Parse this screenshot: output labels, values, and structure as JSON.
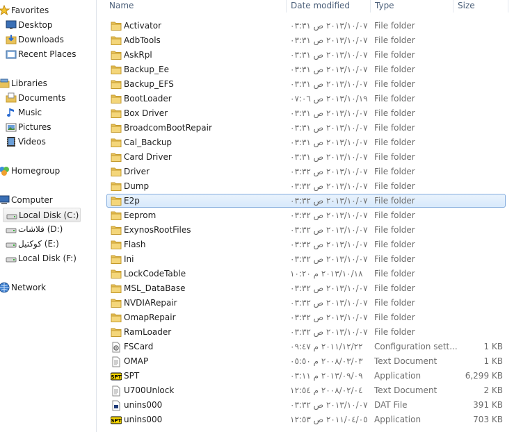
{
  "columns": {
    "name": "Name",
    "date": "Date modified",
    "type": "Type",
    "size": "Size"
  },
  "nav": [
    {
      "label": "Favorites",
      "icon": "star-icon",
      "group": "favorites"
    },
    {
      "label": "Desktop",
      "icon": "desktop-icon"
    },
    {
      "label": "Downloads",
      "icon": "downloads-icon"
    },
    {
      "label": "Recent Places",
      "icon": "recent-places-icon"
    },
    {
      "label": "Libraries",
      "icon": "libraries-icon",
      "group": "libraries"
    },
    {
      "label": "Documents",
      "icon": "documents-icon"
    },
    {
      "label": "Music",
      "icon": "music-icon"
    },
    {
      "label": "Pictures",
      "icon": "pictures-icon"
    },
    {
      "label": "Videos",
      "icon": "videos-icon"
    },
    {
      "label": "Homegroup",
      "icon": "homegroup-icon",
      "group": "homegroup"
    },
    {
      "label": "Computer",
      "icon": "computer-icon",
      "group": "computer"
    },
    {
      "label": "Local Disk (C:)",
      "icon": "drive-icon",
      "selected": true
    },
    {
      "label": "فلاشات (D:)",
      "icon": "drive-icon"
    },
    {
      "label": "كوكتيل (E:)",
      "icon": "drive-icon"
    },
    {
      "label": "Local Disk (F:)",
      "icon": "drive-icon"
    },
    {
      "label": "Network",
      "icon": "network-icon",
      "group": "network"
    }
  ],
  "files": [
    {
      "name": "Activator",
      "date": "٢٠١٣/١٠/٠٧ ص ٠٣:٣١",
      "type": "File folder",
      "size": "",
      "icon": "folder-icon"
    },
    {
      "name": "AdbTools",
      "date": "٢٠١٣/١٠/٠٧ ص ٠٣:٣١",
      "type": "File folder",
      "size": "",
      "icon": "folder-icon"
    },
    {
      "name": "AskRpl",
      "date": "٢٠١٣/١٠/٠٧ ص ٠٣:٣١",
      "type": "File folder",
      "size": "",
      "icon": "folder-icon"
    },
    {
      "name": "Backup_Ee",
      "date": "٢٠١٣/١٠/٠٧ ص ٠٣:٣١",
      "type": "File folder",
      "size": "",
      "icon": "folder-icon"
    },
    {
      "name": "Backup_EFS",
      "date": "٢٠١٣/١٠/٠٧ ص ٠٣:٣١",
      "type": "File folder",
      "size": "",
      "icon": "folder-icon"
    },
    {
      "name": "BootLoader",
      "date": "٢٠١٣/١٠/١٩ ص ٠٧:٠٦",
      "type": "File folder",
      "size": "",
      "icon": "folder-icon"
    },
    {
      "name": "Box Driver",
      "date": "٢٠١٣/١٠/٠٧ ص ٠٣:٣١",
      "type": "File folder",
      "size": "",
      "icon": "folder-icon"
    },
    {
      "name": "BroadcomBootRepair",
      "date": "٢٠١٣/١٠/٠٧ ص ٠٣:٣١",
      "type": "File folder",
      "size": "",
      "icon": "folder-icon"
    },
    {
      "name": "Cal_Backup",
      "date": "٢٠١٣/١٠/٠٧ ص ٠٣:٣١",
      "type": "File folder",
      "size": "",
      "icon": "folder-icon"
    },
    {
      "name": "Card Driver",
      "date": "٢٠١٣/١٠/٠٧ ص ٠٣:٣١",
      "type": "File folder",
      "size": "",
      "icon": "folder-icon"
    },
    {
      "name": "Driver",
      "date": "٢٠١٣/١٠/٠٧ ص ٠٣:٣٢",
      "type": "File folder",
      "size": "",
      "icon": "folder-icon"
    },
    {
      "name": "Dump",
      "date": "٢٠١٣/١٠/٠٧ ص ٠٣:٣٢",
      "type": "File folder",
      "size": "",
      "icon": "folder-icon"
    },
    {
      "name": "E2p",
      "date": "٢٠١٣/١٠/٠٧ ص ٠٣:٣٢",
      "type": "File folder",
      "size": "",
      "icon": "folder-icon",
      "selected": true
    },
    {
      "name": "Eeprom",
      "date": "٢٠١٣/١٠/٠٧ ص ٠٣:٣٢",
      "type": "File folder",
      "size": "",
      "icon": "folder-icon"
    },
    {
      "name": "ExynosRootFiles",
      "date": "٢٠١٣/١٠/٠٧ ص ٠٣:٣٢",
      "type": "File folder",
      "size": "",
      "icon": "folder-icon"
    },
    {
      "name": "Flash",
      "date": "٢٠١٣/١٠/٠٧ ص ٠٣:٣٢",
      "type": "File folder",
      "size": "",
      "icon": "folder-icon"
    },
    {
      "name": "Ini",
      "date": "٢٠١٣/١٠/٠٧ ص ٠٣:٣٢",
      "type": "File folder",
      "size": "",
      "icon": "folder-icon"
    },
    {
      "name": "LockCodeTable",
      "date": "٢٠١٣/١٠/١٨ م ١٠:٢٠",
      "type": "File folder",
      "size": "",
      "icon": "folder-icon"
    },
    {
      "name": "MSL_DataBase",
      "date": "٢٠١٣/١٠/٠٧ ص ٠٣:٣٢",
      "type": "File folder",
      "size": "",
      "icon": "folder-icon"
    },
    {
      "name": "NVDIARepair",
      "date": "٢٠١٣/١٠/٠٧ ص ٠٣:٣٢",
      "type": "File folder",
      "size": "",
      "icon": "folder-icon"
    },
    {
      "name": "OmapRepair",
      "date": "٢٠١٣/١٠/٠٧ ص ٠٣:٣٢",
      "type": "File folder",
      "size": "",
      "icon": "folder-icon"
    },
    {
      "name": "RamLoader",
      "date": "٢٠١٣/١٠/٠٧ ص ٠٣:٣٢",
      "type": "File folder",
      "size": "",
      "icon": "folder-icon"
    },
    {
      "name": "FSCard",
      "date": "٢٠١١/١٢/٢٢ م ٠٩:٤٧",
      "type": "Configuration sett...",
      "size": "1 KB",
      "icon": "config-file-icon"
    },
    {
      "name": "OMAP",
      "date": "٢٠٠٨/٠٣/٠٣ م ٠٥:٥٠",
      "type": "Text Document",
      "size": "1 KB",
      "icon": "text-file-icon"
    },
    {
      "name": "SPT",
      "date": "٢٠١٣/٠٩/٠٩ م ٠٣:١١",
      "type": "Application",
      "size": "6,299 KB",
      "icon": "spt-app-icon"
    },
    {
      "name": "U700Unlock",
      "date": "٢٠٠٨/٠٢/٠٤ م ١٢:٥٤",
      "type": "Text Document",
      "size": "2 KB",
      "icon": "text-file-icon"
    },
    {
      "name": "unins000",
      "date": "٢٠١٣/١٠/٠٧ ص ٠٣:٣٢",
      "type": "DAT File",
      "size": "391 KB",
      "icon": "dat-file-icon"
    },
    {
      "name": "unins000",
      "date": "٢٠١١/٠٤/٠٥ ص ١٢:٥٣",
      "type": "Application",
      "size": "703 KB",
      "icon": "spt-app-icon"
    }
  ]
}
